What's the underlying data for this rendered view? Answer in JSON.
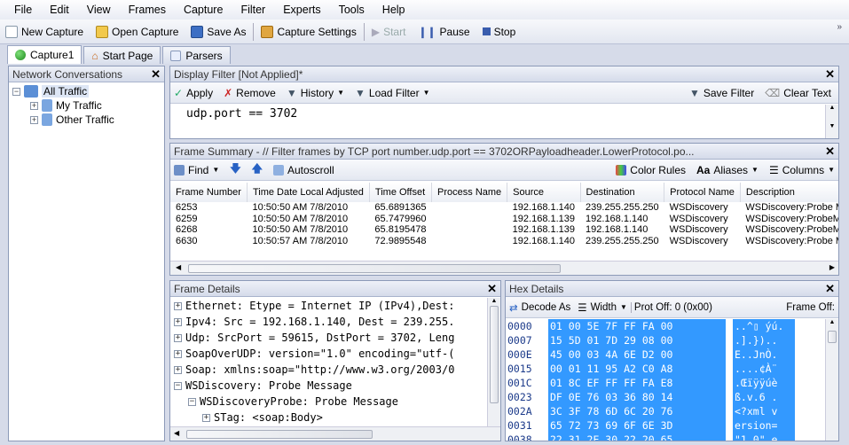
{
  "menu": [
    "File",
    "Edit",
    "View",
    "Frames",
    "Capture",
    "Filter",
    "Experts",
    "Tools",
    "Help"
  ],
  "toolbar": {
    "new_capture": "New Capture",
    "open_capture": "Open Capture",
    "save_as": "Save As",
    "capture_settings": "Capture Settings",
    "start": "Start",
    "pause": "Pause",
    "stop": "Stop"
  },
  "tabs": [
    "Capture1",
    "Start Page",
    "Parsers"
  ],
  "network": {
    "title": "Network Conversations",
    "items": [
      "All Traffic",
      "My Traffic",
      "Other Traffic"
    ]
  },
  "display_filter": {
    "title": "Display Filter [Not Applied]*",
    "apply": "Apply",
    "remove": "Remove",
    "history": "History",
    "load_filter": "Load Filter",
    "save_filter": "Save Filter",
    "clear_text": "Clear Text",
    "text": "udp.port == 3702"
  },
  "frame_summary": {
    "title": "Frame Summary - // Filter frames by TCP port number.udp.port == 3702ORPayloadheader.LowerProtocol.po...",
    "find": "Find",
    "autoscroll": "Autoscroll",
    "color_rules": "Color Rules",
    "aliases": "Aliases",
    "columns": "Columns",
    "headers": [
      "Frame Number",
      "Time Date Local Adjusted",
      "Time Offset",
      "Process Name",
      "Source",
      "Destination",
      "Protocol Name",
      "Description"
    ],
    "rows": [
      [
        "6253",
        "10:50:50 AM 7/8/2010",
        "65.6891365",
        "",
        "192.168.1.140",
        "239.255.255.250",
        "WSDiscovery",
        "WSDiscovery:Probe Messa"
      ],
      [
        "6259",
        "10:50:50 AM 7/8/2010",
        "65.7479960",
        "",
        "192.168.1.139",
        "192.168.1.140",
        "WSDiscovery",
        "WSDiscovery:ProbeMatch"
      ],
      [
        "6268",
        "10:50:50 AM 7/8/2010",
        "65.8195478",
        "",
        "192.168.1.139",
        "192.168.1.140",
        "WSDiscovery",
        "WSDiscovery:ProbeMatch"
      ],
      [
        "6630",
        "10:50:57 AM 7/8/2010",
        "72.9895548",
        "",
        "192.168.1.140",
        "239.255.255.250",
        "WSDiscovery",
        "WSDiscovery:Probe Messa"
      ]
    ]
  },
  "frame_details": {
    "title": "Frame Details",
    "lines": [
      "Ethernet: Etype = Internet IP (IPv4),Dest:",
      "Ipv4: Src = 192.168.1.140, Dest = 239.255.",
      "Udp: SrcPort = 59615, DstPort = 3702, Leng",
      "SoapOverUDP: version=\"1.0\" encoding=\"utf-(",
      "Soap: xmlns:soap=\"http://www.w3.org/2003/0",
      "WSDiscovery: Probe Message",
      "WSDiscoveryProbe: Probe Message",
      "STag: <soap:Body>"
    ]
  },
  "hex_details": {
    "title": "Hex Details",
    "decode_as": "Decode As",
    "width": "Width",
    "prot_off": "Prot Off: 0 (0x00)",
    "frame_off": "Frame Off:",
    "rows": [
      [
        "0000",
        "01 00 5E 7F FF FA 00",
        "..^▯ ýú."
      ],
      [
        "0007",
        "15 5D 01 7D 29 08 00",
        ".].}).."
      ],
      [
        "000E",
        "45 00 03 4A 6E D2 00",
        "E..JnÒ."
      ],
      [
        "0015",
        "00 01 11 95 A2 C0 A8",
        "....¢À¨"
      ],
      [
        "001C",
        "01 8C EF FF FF FA E8",
        ".Œïÿÿúè"
      ],
      [
        "0023",
        "DF 0E 76 03 36 80 14",
        "ß.v.6 ."
      ],
      [
        "002A",
        "3C 3F 78 6D 6C 20 76",
        "<?xml v"
      ],
      [
        "0031",
        "65 72 73 69 6F 6E 3D",
        "ersion="
      ],
      [
        "0038",
        "22 31 2E 30 22 20 65",
        "\"1.0\" e"
      ]
    ]
  }
}
